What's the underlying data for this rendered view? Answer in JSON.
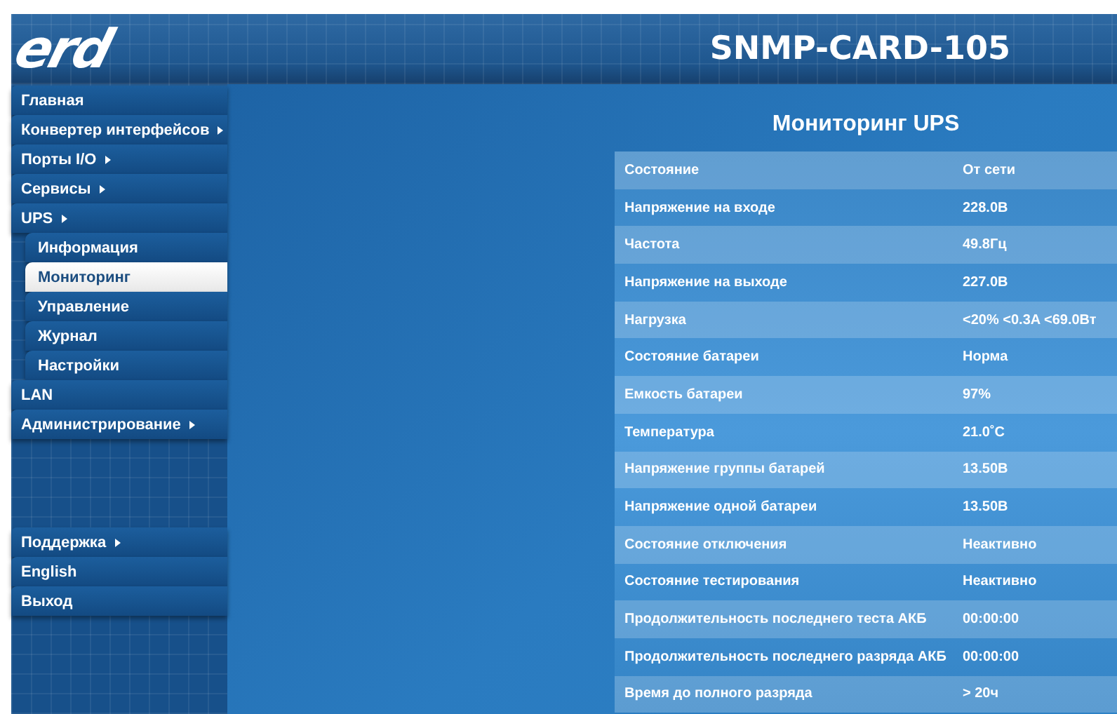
{
  "header": {
    "logo": "erd",
    "title": "SNMP-CARD-105"
  },
  "sidebar": {
    "items": [
      {
        "label": "Главная",
        "submenu": false
      },
      {
        "label": "Конвертер интерфейсов",
        "submenu": true
      },
      {
        "label": "Порты I/O",
        "submenu": true
      },
      {
        "label": "Сервисы",
        "submenu": true
      },
      {
        "label": "UPS",
        "submenu": true,
        "children": [
          {
            "label": "Информация",
            "selected": false
          },
          {
            "label": "Мониторинг",
            "selected": true
          },
          {
            "label": "Управление",
            "selected": false
          },
          {
            "label": "Журнал",
            "selected": false
          },
          {
            "label": "Настройки",
            "selected": false
          }
        ]
      },
      {
        "label": "LAN",
        "submenu": false
      },
      {
        "label": "Администрирование",
        "submenu": true
      }
    ],
    "bottom_items": [
      {
        "label": "Поддержка",
        "submenu": true
      },
      {
        "label": "English",
        "submenu": false
      },
      {
        "label": "Выход",
        "submenu": false
      }
    ]
  },
  "panel": {
    "title": "Мониторинг UPS",
    "rows": [
      {
        "label": "Состояние",
        "value": "От сети"
      },
      {
        "label": "Напряжение на входе",
        "value": "228.0В"
      },
      {
        "label": "Частота",
        "value": "49.8Гц"
      },
      {
        "label": "Напряжение на выходе",
        "value": "227.0В"
      },
      {
        "label": "Нагрузка",
        "value": "<20% <0.3A <69.0Вт"
      },
      {
        "label": "Состояние батареи",
        "value": "Норма"
      },
      {
        "label": "Емкость батареи",
        "value": "97%"
      },
      {
        "label": "Температура",
        "value": "21.0˚C"
      },
      {
        "label": "Напряжение группы батарей",
        "value": "13.50В"
      },
      {
        "label": "Напряжение одной батареи",
        "value": "13.50В"
      },
      {
        "label": "Состояние отключения",
        "value": "Неактивно"
      },
      {
        "label": "Состояние тестирования",
        "value": "Неактивно"
      },
      {
        "label": "Продолжительность последнего теста АКБ",
        "value": "00:00:00"
      },
      {
        "label": "Продолжительность последнего разряда АКБ",
        "value": "00:00:00"
      },
      {
        "label": "Время до полного разряда",
        "value": "> 20ч"
      }
    ]
  }
}
